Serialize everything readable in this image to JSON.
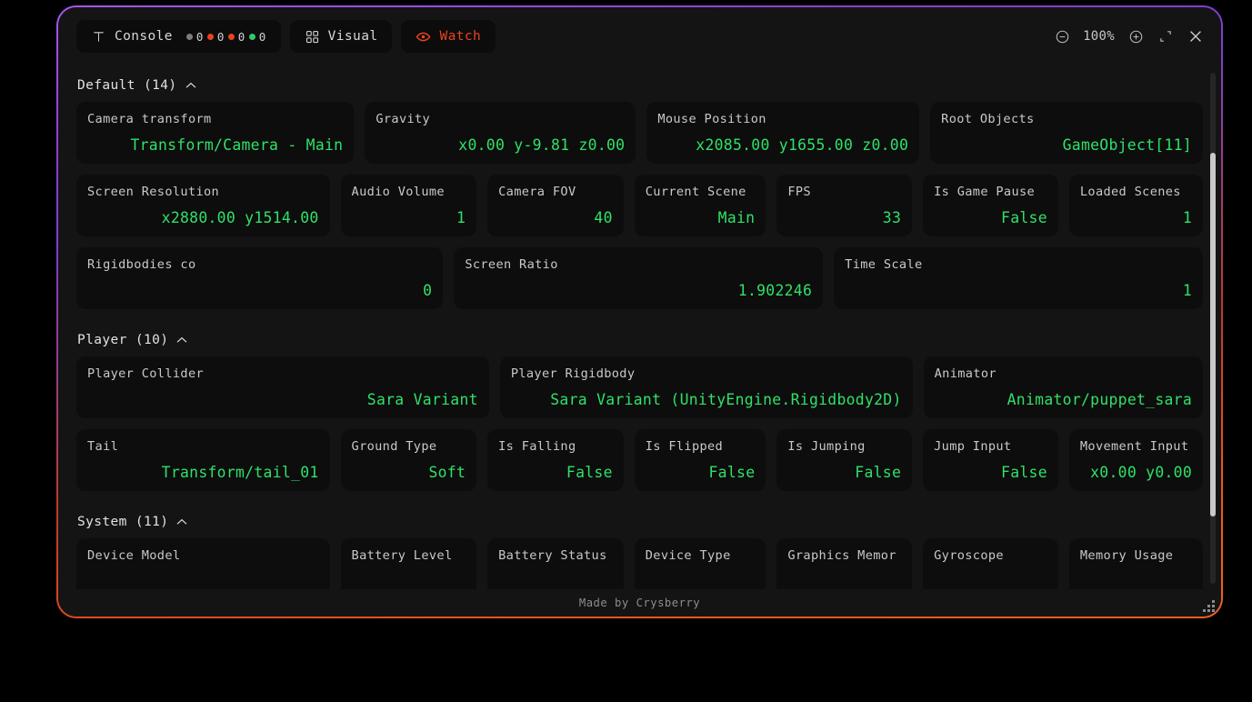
{
  "window": {
    "border_gradient_top": "#a855f7",
    "border_gradient_bottom": "#f4601f",
    "background": "#141414"
  },
  "topbar": {
    "tabs": [
      {
        "id": "console",
        "label": "Console",
        "icon": "text-t-icon",
        "active": false,
        "counters": [
          {
            "color": "#7d7d7d",
            "value": "0"
          },
          {
            "color": "#e8441c",
            "value": "0"
          },
          {
            "color": "#e8441c",
            "value": "0"
          },
          {
            "color": "#31c96a",
            "value": "0"
          }
        ]
      },
      {
        "id": "visual",
        "label": "Visual",
        "icon": "grid-squares-icon",
        "active": false,
        "counters": []
      },
      {
        "id": "watch",
        "label": "Watch",
        "icon": "eye-icon",
        "active": true,
        "counters": []
      }
    ],
    "zoom_out_icon": "minus-circle-icon",
    "zoom_level": "100%",
    "zoom_in_icon": "plus-circle-icon",
    "expand_icon": "expand-corner-icon",
    "close_icon": "close-icon"
  },
  "sections": [
    {
      "id": "default",
      "title": "Default (14)",
      "collapse_icon": "chevron-up-icon",
      "rows": [
        [
          {
            "label": "Camera transform",
            "value": "Transform/Camera - Main",
            "flex": 3.06
          },
          {
            "label": "Gravity",
            "value": "x0.00 y-9.81 z0.00",
            "flex": 2.98
          },
          {
            "label": "Mouse Position",
            "value": "x2085.00 y1655.00 z0.00",
            "flex": 3.0
          },
          {
            "label": "Root Objects",
            "value": "GameObject[11]",
            "flex": 3.0
          }
        ],
        [
          {
            "label": "Screen Resolution",
            "value": "x2880.00 y1514.00",
            "flex": 3.06
          },
          {
            "label": "Audio Volume",
            "value": "1",
            "flex": 1.51
          },
          {
            "label": "Camera FOV",
            "value": "40",
            "flex": 1.51
          },
          {
            "label": "Current Scene",
            "value": "Main",
            "flex": 1.45
          },
          {
            "label": "FPS",
            "value": "33",
            "flex": 1.5
          },
          {
            "label": "Is Game Pause",
            "value": "False",
            "flex": 1.5
          },
          {
            "label": "Loaded Scenes",
            "value": "1",
            "flex": 1.48
          }
        ],
        [
          {
            "label": "Rigidbodies co",
            "value": "0",
            "flex": 1.5
          },
          {
            "label": "Screen Ratio",
            "value": "1.902246",
            "flex": 1.51
          },
          {
            "label": "Time Scale",
            "value": "1",
            "flex": 1.51
          }
        ]
      ]
    },
    {
      "id": "player",
      "title": "Player (10)",
      "collapse_icon": "chevron-up-icon",
      "rows": [
        [
          {
            "label": "Player Collider",
            "value": "Sara Variant",
            "flex": 4.55
          },
          {
            "label": "Player Rigidbody",
            "value": "Sara Variant (UnityEngine.Rigidbody2D)",
            "flex": 4.55
          },
          {
            "label": "Animator",
            "value": "Animator/puppet_sara",
            "flex": 3.0
          }
        ],
        [
          {
            "label": "Tail",
            "value": "Transform/tail_01",
            "flex": 3.06
          },
          {
            "label": "Ground Type",
            "value": "Soft",
            "flex": 1.51
          },
          {
            "label": "Is Falling",
            "value": "False",
            "flex": 1.51
          },
          {
            "label": "Is Flipped",
            "value": "False",
            "flex": 1.45
          },
          {
            "label": "Is Jumping",
            "value": "False",
            "flex": 1.5
          },
          {
            "label": "Jump Input",
            "value": "False",
            "flex": 1.5
          },
          {
            "label": "Movement Input",
            "value": "x0.00 y0.00",
            "flex": 1.48
          }
        ]
      ]
    },
    {
      "id": "system",
      "title": "System (11)",
      "collapse_icon": "chevron-up-icon",
      "rows": [
        [
          {
            "label": "Device Model",
            "value": "",
            "flex": 3.06
          },
          {
            "label": "Battery Level",
            "value": "",
            "flex": 1.51
          },
          {
            "label": "Battery Status",
            "value": "",
            "flex": 1.51
          },
          {
            "label": "Device Type",
            "value": "",
            "flex": 1.45
          },
          {
            "label": "Graphics Memor",
            "value": "",
            "flex": 1.5
          },
          {
            "label": "Gyroscope",
            "value": "",
            "flex": 1.5
          },
          {
            "label": "Memory Usage",
            "value": "",
            "flex": 1.48
          }
        ]
      ]
    }
  ],
  "scrollbar": {
    "thumb_color": "#c9c9c9",
    "track_color": "#262626"
  },
  "footer": {
    "credit": "Made by Crysberry",
    "resize_grip_icon": "resize-grip-icon"
  }
}
